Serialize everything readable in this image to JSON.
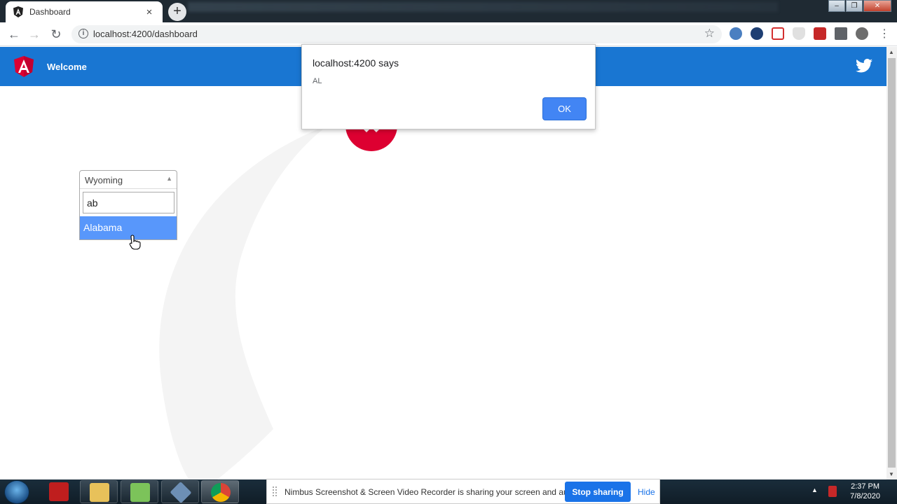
{
  "browser": {
    "tab_title": "Dashboard",
    "tab_close": "×",
    "new_tab": "+",
    "url": "localhost:4200/dashboard",
    "window_controls": [
      "–",
      "❐",
      "✕"
    ]
  },
  "app": {
    "header_title": "Welcome",
    "brand_color": "#1976d2",
    "angular_red": "#dd0031"
  },
  "select": {
    "selected": "Wyoming",
    "search_value": "ab",
    "highlighted_option": "Alabama"
  },
  "alert": {
    "title": "localhost:4200 says",
    "message": "AL",
    "ok_label": "OK"
  },
  "share_bar": {
    "message": "Nimbus Screenshot & Screen Video Recorder is sharing your screen and audio.",
    "stop_label": "Stop sharing",
    "hide_label": "Hide"
  },
  "taskbar": {
    "time": "2:37 PM",
    "date": "7/8/2020"
  }
}
